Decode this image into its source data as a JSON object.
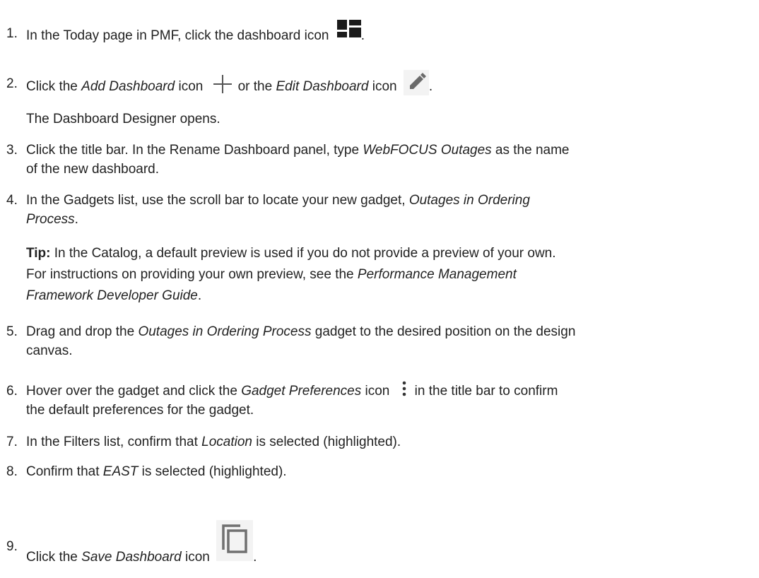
{
  "steps": [
    {
      "num": "1.",
      "t1": "In the Today page in PMF, click the dashboard icon",
      "t2": "."
    },
    {
      "num": "2.",
      "t1": "Click the ",
      "e1": "Add Dashboard",
      "t2": " icon",
      "t3": "or the ",
      "e2": "Edit Dashboard",
      "t4": " icon",
      "t5": "."
    },
    {
      "num": "3.",
      "t1": "Click the title bar. In the Rename Dashboard panel, type ",
      "e1": "WebFOCUS Outages",
      "t2": " as the name",
      "l2": "of the new dashboard."
    },
    {
      "num": "4.",
      "t1": "In the Gadgets list, use the scroll bar to locate your new gadget, ",
      "e1": "Outages in Ordering",
      "e2": "Process",
      "t2": "."
    },
    {
      "num": "5.",
      "t1": "Drag and drop the ",
      "e1": "Outages in Ordering Process",
      "t2": " gadget to the desired position on the design",
      "l2": "canvas."
    },
    {
      "num": "6.",
      "t1": "Hover over the gadget and click the ",
      "e1": "Gadget Preferences",
      "t2": " icon",
      "t3": "in the title bar to confirm",
      "l2": "the default preferences for the gadget."
    },
    {
      "num": "7.",
      "t1": "In the Filters list, confirm that ",
      "e1": "Location",
      "t2": " is selected (highlighted)."
    },
    {
      "num": "8.",
      "t1": "Confirm that ",
      "e1": "EAST",
      "t2": " is selected (highlighted)."
    },
    {
      "num": "9.",
      "t1": "Click the ",
      "e1": "Save Dashboard",
      "t2": " icon",
      "t3": "."
    }
  ],
  "designer_opens": "The Dashboard Designer opens.",
  "tip": {
    "label": "Tip:",
    "l1": " In the Catalog, a default preview is used if you do not provide a preview of your own.",
    "l2a": "For instructions on providing your own preview, see the ",
    "l2e": "Performance Management",
    "l3e": "Framework Developer Guide",
    "l3b": "."
  },
  "icons": [
    "dashboard-icon",
    "add-dashboard-icon",
    "edit-dashboard-icon",
    "gadget-preferences-icon",
    "save-dashboard-icon"
  ]
}
